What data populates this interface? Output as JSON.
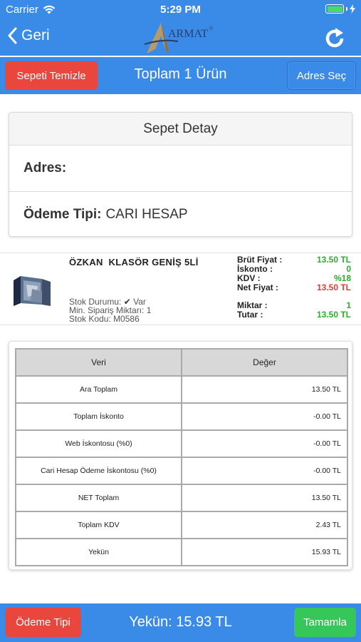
{
  "status_bar": {
    "carrier": "Carrier",
    "time": "5:29 PM",
    "wifi_icon": "wifi-icon",
    "battery_icon": "battery-icon",
    "charging_icon": "bolt-icon"
  },
  "nav": {
    "back_label": "Geri",
    "logo_text": "ARMAT",
    "logo_mark": "®",
    "refresh_icon": "refresh-icon"
  },
  "toolbar": {
    "clear_label": "Sepeti Temizle",
    "title": "Toplam 1 Ürün",
    "address_label": "Adres Seç"
  },
  "detail": {
    "title": "Sepet Detay",
    "address_label": "Adres:",
    "address_value": "",
    "payment_label": "Ödeme Tipi:",
    "payment_value": "CARI HESAP"
  },
  "product": {
    "name": "ÖZKAN  KLASÖR GENİŞ 5Lİ",
    "stock_status_label": "Stok Durumu:",
    "stock_status_value": "Var",
    "min_order_label": "Min. Sipariş Miktarı:",
    "min_order_value": "1",
    "stock_code_label": "Stok Kodu:",
    "stock_code_value": "M0586",
    "gross_label": "Brüt Fiyat :",
    "gross_value": "13.50 TL",
    "discount_label": "İskonto :",
    "discount_value": "0",
    "vat_label": "KDV :",
    "vat_value": "%18",
    "net_label": "Net Fiyat :",
    "net_value": "13.50 TL",
    "qty_label": "Miktar :",
    "qty_value": "1",
    "amount_label": "Tutar :",
    "amount_value": "13.50 TL"
  },
  "summary": {
    "headers": [
      "Veri",
      "Değer"
    ],
    "rows": [
      {
        "label": "Ara Toplam",
        "value": "13.50 TL"
      },
      {
        "label": "Toplam İskonto",
        "value": "-0.00 TL"
      },
      {
        "label": "Web İskontosu (%0)",
        "value": "-0.00 TL"
      },
      {
        "label": "Cari Hesap Ödeme İskontosu (%0)",
        "value": "-0.00 TL"
      },
      {
        "label": "NET Toplam",
        "value": "13.50 TL"
      },
      {
        "label": "Toplam KDV",
        "value": "2.43 TL"
      },
      {
        "label": "Yekün",
        "value": "15.93 TL"
      }
    ]
  },
  "bottom": {
    "payment_label": "Ödeme Tipi",
    "total_text": "Yekün: 15.93 TL",
    "done_label": "Tamamla"
  },
  "colors": {
    "primary": "#3a8be8",
    "danger": "#e9473e",
    "success": "#35c759",
    "price_green": "#2bae2b",
    "price_red": "#e23b3b"
  }
}
